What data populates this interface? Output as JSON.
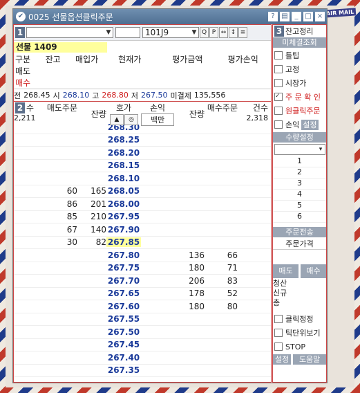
{
  "window": {
    "code": "0025",
    "title": "선물옵션클릭주문",
    "stamp": "AIR MAIL"
  },
  "toolbar": {
    "section": "1",
    "account": "",
    "password": "",
    "code": "101J9",
    "search": "Q",
    "p": "P"
  },
  "futures": {
    "name": "선물 1409"
  },
  "positions": {
    "headers": [
      "구분",
      "잔고",
      "매입가",
      "현재가",
      "평가금액",
      "평가손익"
    ],
    "rows": [
      "매도",
      "매수"
    ]
  },
  "summary": {
    "prev_label": "전",
    "prev": "268.45",
    "open_label": "시",
    "open": "268.10",
    "high_label": "고",
    "high": "268.80",
    "low_label": "저",
    "low": "267.50",
    "oi_label": "미결제",
    "oi": "135,556"
  },
  "orderbook": {
    "section": "2",
    "count_label": "수",
    "sell_order_label": "매도주문",
    "sell_rem_label": "잔량",
    "price_label": "호가",
    "pl_label": "손익",
    "pl_unit": "백만",
    "buy_rem_label": "잔량",
    "buy_order_label": "매수주문",
    "cnt_label": "건수",
    "sell_count": "2,211",
    "buy_count": "2,318",
    "rows": [
      {
        "sq": "",
        "sr": "",
        "p": "268.30",
        "br": "",
        "bq": ""
      },
      {
        "sq": "",
        "sr": "",
        "p": "268.25",
        "br": "",
        "bq": ""
      },
      {
        "sq": "",
        "sr": "",
        "p": "268.20",
        "br": "",
        "bq": ""
      },
      {
        "sq": "",
        "sr": "",
        "p": "268.15",
        "br": "",
        "bq": ""
      },
      {
        "sq": "",
        "sr": "",
        "p": "268.10",
        "br": "",
        "bq": ""
      },
      {
        "sq": "60",
        "sr": "165",
        "p": "268.05",
        "br": "",
        "bq": ""
      },
      {
        "sq": "86",
        "sr": "201",
        "p": "268.00",
        "br": "",
        "bq": ""
      },
      {
        "sq": "85",
        "sr": "210",
        "p": "267.95",
        "br": "",
        "bq": ""
      },
      {
        "sq": "67",
        "sr": "140",
        "p": "267.90",
        "br": "",
        "bq": ""
      },
      {
        "sq": "30",
        "sr": "82",
        "p": "267.85",
        "br": "",
        "bq": ""
      },
      {
        "sq": "",
        "sr": "",
        "p": "267.80",
        "br": "136",
        "bq": "66"
      },
      {
        "sq": "",
        "sr": "",
        "p": "267.75",
        "br": "180",
        "bq": "71"
      },
      {
        "sq": "",
        "sr": "",
        "p": "267.70",
        "br": "206",
        "bq": "83"
      },
      {
        "sq": "",
        "sr": "",
        "p": "267.65",
        "br": "178",
        "bq": "52"
      },
      {
        "sq": "",
        "sr": "",
        "p": "267.60",
        "br": "180",
        "bq": "80"
      },
      {
        "sq": "",
        "sr": "",
        "p": "267.55",
        "br": "",
        "bq": ""
      },
      {
        "sq": "",
        "sr": "",
        "p": "267.50",
        "br": "",
        "bq": ""
      },
      {
        "sq": "",
        "sr": "",
        "p": "267.45",
        "br": "",
        "bq": ""
      },
      {
        "sq": "",
        "sr": "",
        "p": "267.40",
        "br": "",
        "bq": ""
      },
      {
        "sq": "",
        "sr": "",
        "p": "267.35",
        "br": "",
        "bq": ""
      }
    ]
  },
  "right_panel": {
    "section": "3",
    "balance": "잔고정리",
    "unfilled": "미체결조회",
    "checks": [
      "틀팁",
      "고정",
      "시장가"
    ],
    "confirm": "주 문 확 인",
    "oneclick": "원클릭주문",
    "stoploss": "손익",
    "setup": "설정",
    "qty_setup": "수량설정",
    "qty": [
      "1",
      "2",
      "3",
      "4",
      "5",
      "6"
    ],
    "send": "주문전송",
    "order_price": "주문가격",
    "sell": "매도",
    "buy": "매수",
    "liquidate": "청산",
    "new": "신규",
    "total": "총",
    "click_fix": "클릭정정",
    "tick_view": "틱단위보기",
    "stop": "STOP",
    "setup2": "설정",
    "help": "도움말"
  },
  "colors": {
    "accent": "#c44",
    "price": "#1a3a9a",
    "highlight": "#ffff9c"
  }
}
